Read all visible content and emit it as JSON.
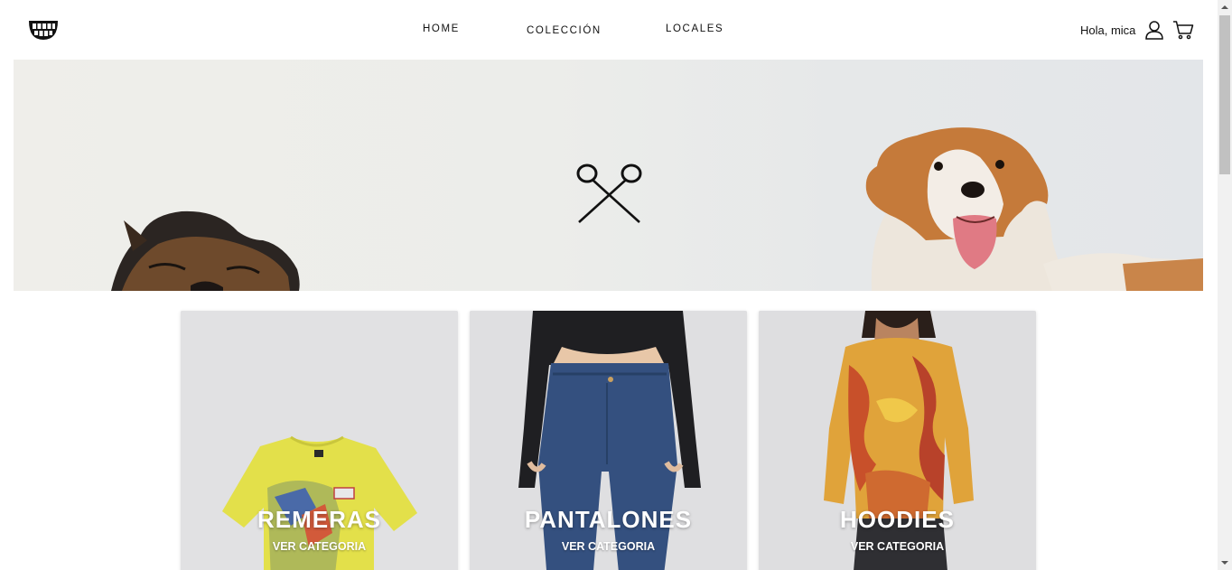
{
  "header": {
    "logo_icon": "grin-teeth-logo-icon",
    "nav": [
      {
        "label": "HOME"
      },
      {
        "label": "COLECCIÓN"
      },
      {
        "label": "LOCALES"
      }
    ],
    "greeting": "Hola, mica",
    "user_icon": "user-icon",
    "cart_icon": "cart-icon"
  },
  "hero": {
    "center_icon": "scissors-icon"
  },
  "categories": [
    {
      "title": "REMERAS",
      "link": "VER CATEGORIA"
    },
    {
      "title": "PANTALONES",
      "link": "VER CATEGORIA"
    },
    {
      "title": "HOODIES",
      "link": "VER CATEGORIA"
    }
  ],
  "colors": {
    "background": "#ffffff",
    "text": "#111111",
    "card_bg": "#e1e1e3",
    "scrollbar_track": "#f1f1f1",
    "scrollbar_thumb": "#c1c1c1"
  }
}
